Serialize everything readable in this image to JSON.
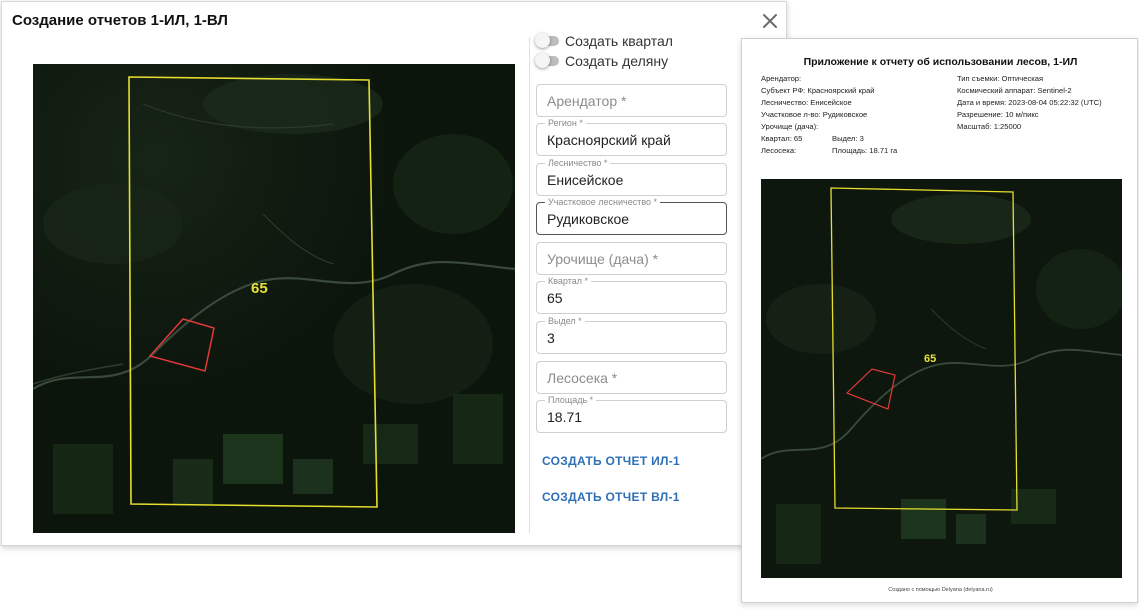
{
  "dialog": {
    "title": "Создание отчетов 1-ИЛ, 1-ВЛ",
    "close_icon": "close-icon",
    "map": {
      "quarter_label": "65"
    },
    "toggles": [
      {
        "label": "Создать квартал",
        "on": false
      },
      {
        "label": "Создать деляну",
        "on": false
      }
    ],
    "fields": {
      "arendator": {
        "placeholder": "Арендатор *",
        "value": ""
      },
      "region": {
        "label": "Регион *",
        "value": "Красноярский край"
      },
      "lesnichestvo": {
        "label": "Лесничество *",
        "value": "Енисейское"
      },
      "uchastkovoe": {
        "label": "Участковое лесничество *",
        "value": "Рудиковское"
      },
      "urochishche": {
        "placeholder": "Урочище (дача) *",
        "value": ""
      },
      "kvartal": {
        "label": "Квартал *",
        "value": "65"
      },
      "vydel": {
        "label": "Выдел *",
        "value": "3"
      },
      "lesoseka": {
        "placeholder": "Лесосека *",
        "value": ""
      },
      "ploshchad": {
        "label": "Площадь *",
        "value": "18.71"
      }
    },
    "buttons": {
      "report_il": "СОЗДАТЬ ОТЧЕТ ИЛ-1",
      "report_vl": "СОЗДАТЬ ОТЧЕТ ВЛ-1"
    }
  },
  "report": {
    "title": "Приложение к отчету об использовании лесов, 1-ИЛ",
    "left": {
      "arendator": "Арендатор:",
      "subject": "Субъект РФ: Красноярский край",
      "lesnichestvo": "Лесничество: Енисейское",
      "uchastkovoe": "Участковое л-во: Рудиковское",
      "urochishche": "Урочище (дача):",
      "kvartal": "Квартал: 65",
      "vydel": "Выдел: 3",
      "lesoseka": "Лесосека:",
      "ploshchad": "Площадь: 18.71 га"
    },
    "right": {
      "survey": "Тип съемки: Оптическая",
      "satellite": "Космический аппарат: Sentinel-2",
      "datetime": "Дата и время: 2023-08-04 05:22:32 (UTC)",
      "resolution": "Разрешение: 10 м/пикс",
      "scale": "Масштаб: 1:25000"
    },
    "map": {
      "quarter_label": "65"
    },
    "footer": "Создано с помощью Delyana (delyana.ru)"
  },
  "colors": {
    "accent": "#2f6fb6",
    "boundary": "#e6df2f",
    "plot": "#e03a3a",
    "imagery": "#0d170d"
  }
}
